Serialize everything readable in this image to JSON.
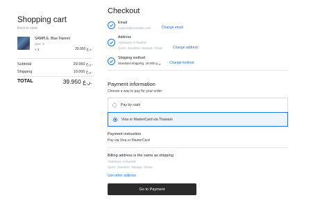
{
  "cart": {
    "title": "Shopping cart",
    "back_link": "Back to store",
    "product": {
      "name": "SAMPLE, Blue Flannel",
      "size": "Size: S",
      "qty": "× 1",
      "price": "29.950 ر.ع."
    },
    "subtotal_label": "Subtotal",
    "subtotal_value": "29.950 ر.ع.",
    "shipping_label": "Shipping",
    "shipping_value": "10.000 ر.ع.",
    "total_label": "TOTAL",
    "total_value": "39.950 ر.ع."
  },
  "checkout": {
    "title": "Checkout",
    "steps": [
      {
        "label": "Email",
        "value": "support@example.com",
        "link": "Change email"
      },
      {
        "label": "Address",
        "value_line1": "Abdulaziz Al Rashdi",
        "value_line2": "Qurm, Bowsher, Masqat, Oman",
        "link": "Change address"
      },
      {
        "label": "Shipping method",
        "value": "Standard shipping, 10.000 ر.ع.",
        "link": "Change method"
      }
    ],
    "payment": {
      "title": "Payment information",
      "subtitle": "Choose a way to pay for your order:",
      "options": [
        {
          "label": "Pay by cash",
          "selected": false
        },
        {
          "label": "Visa or MasterCard via Thawani",
          "selected": true
        }
      ]
    },
    "instruction": {
      "title": "Payment instruction",
      "text": "Pay via Visa or MasterCard"
    },
    "billing": {
      "title": "Billing address is the same as shipping",
      "line1": "Abdulaziz Al Rashdi",
      "line2": "Qurm, Bowsher, Masqat, Oman",
      "other_link": "Use other address"
    },
    "button": "Go to Payment"
  },
  "colors": {
    "accent": "#1a73e8",
    "button_bg": "#2b2b2b",
    "selected_bg": "#eef4fd"
  }
}
